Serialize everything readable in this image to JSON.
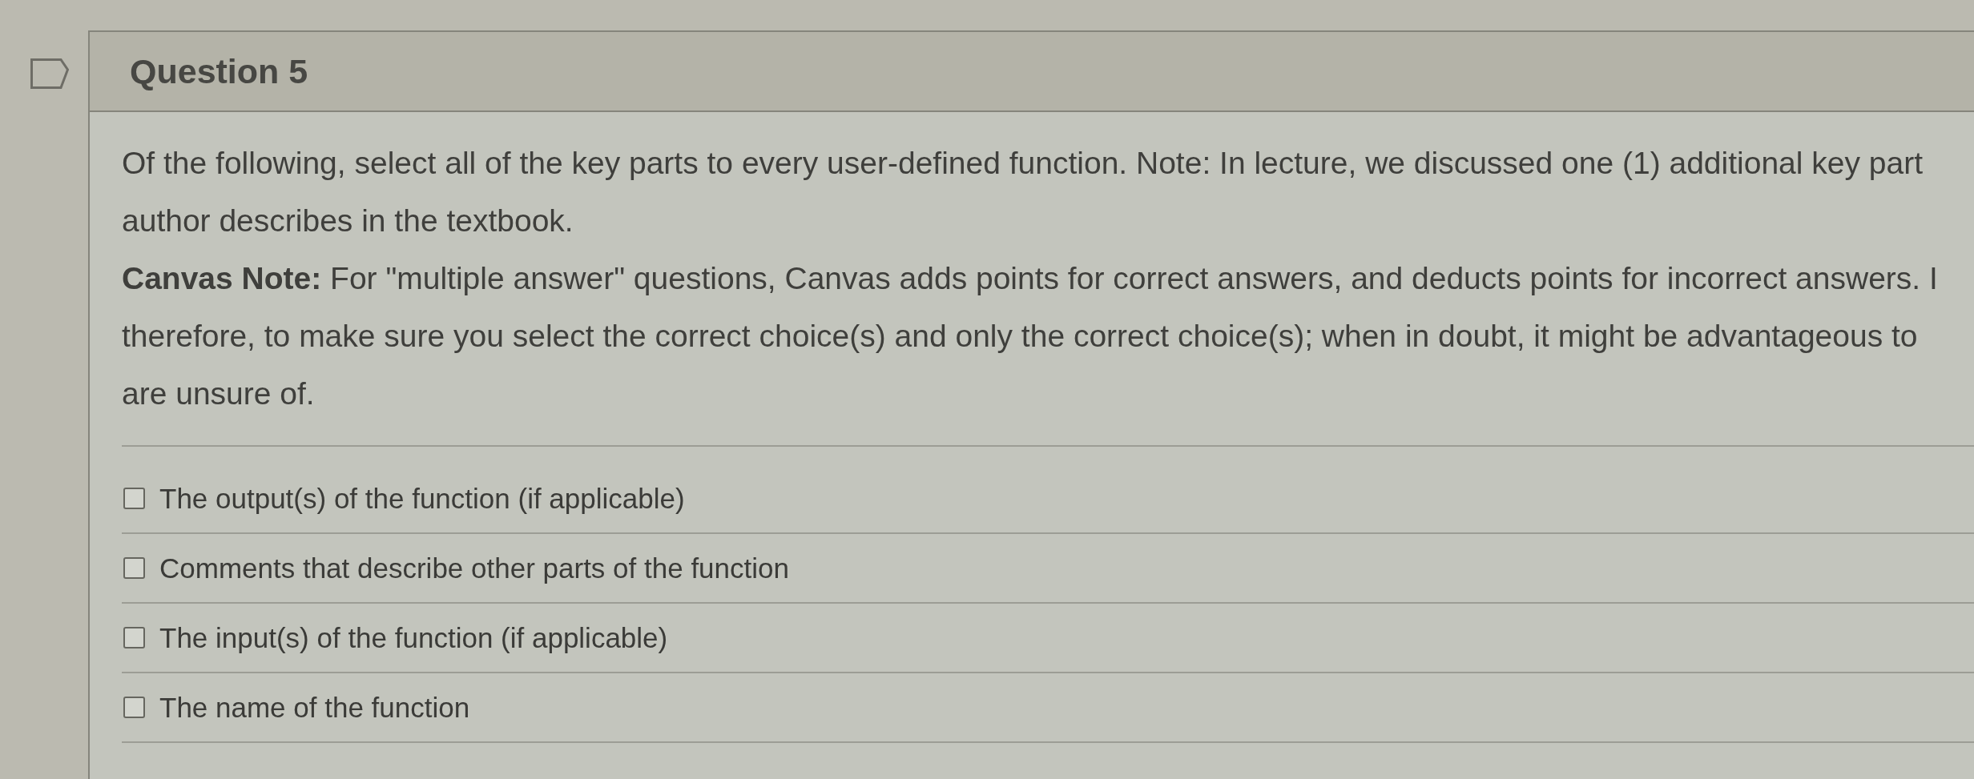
{
  "question": {
    "flagged": false,
    "title": "Question 5"
  },
  "prompt": {
    "lines": [
      "Of the following, select all of the key parts to every user-defined function. Note: In lecture, we discussed one (1) additional key part",
      "author describes in the textbook."
    ]
  },
  "note": {
    "lines": [
      "**Canvas Note:** For \"multiple answer\" questions, Canvas adds points for correct answers, and deducts points for incorrect answers. I",
      "therefore, to make sure you select the correct choice(s) and only the correct choice(s); when in doubt, it might be advantageous to",
      "are unsure of."
    ]
  },
  "options": [
    {
      "label": "The output(s) of the function (if applicable)",
      "checked": false
    },
    {
      "label": "Comments that describe other parts of the function",
      "checked": false
    },
    {
      "label": "The input(s) of the function (if applicable)",
      "checked": false
    },
    {
      "label": "The name of the function",
      "checked": false
    }
  ]
}
